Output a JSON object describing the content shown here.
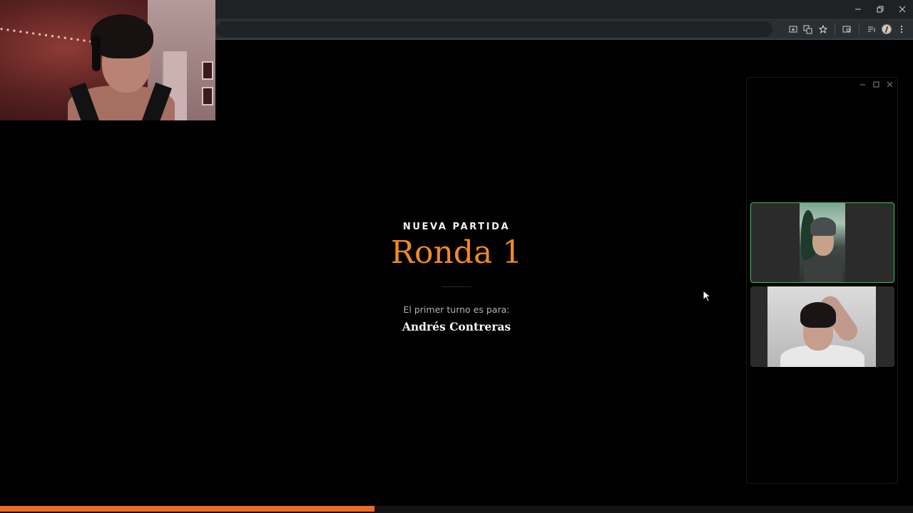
{
  "browser": {
    "window_controls": {
      "minimize_icon": "minimize-icon",
      "restore_icon": "restore-icon",
      "close_icon": "close-icon"
    },
    "toolbar_icons": [
      "install-app-icon",
      "translate-icon",
      "bookmark-star-icon",
      "tab-search-icon",
      "media-controls-icon",
      "profile-avatar-icon",
      "more-menu-icon"
    ]
  },
  "game": {
    "kicker": "NUEVA PARTIDA",
    "round_title": "Ronda 1",
    "turn_label": "El primer turno es para:",
    "player_name": "Andrés Contreras"
  },
  "participants_panel": {
    "controls": [
      "minimize-icon",
      "maximize-icon",
      "close-icon"
    ],
    "tiles": [
      {
        "active": true
      },
      {
        "active": false
      }
    ]
  },
  "progress": {
    "fraction": 0.41,
    "color": "#f06a21"
  },
  "colors": {
    "accent": "#f08a24",
    "active_border": "#3dbb5c"
  }
}
